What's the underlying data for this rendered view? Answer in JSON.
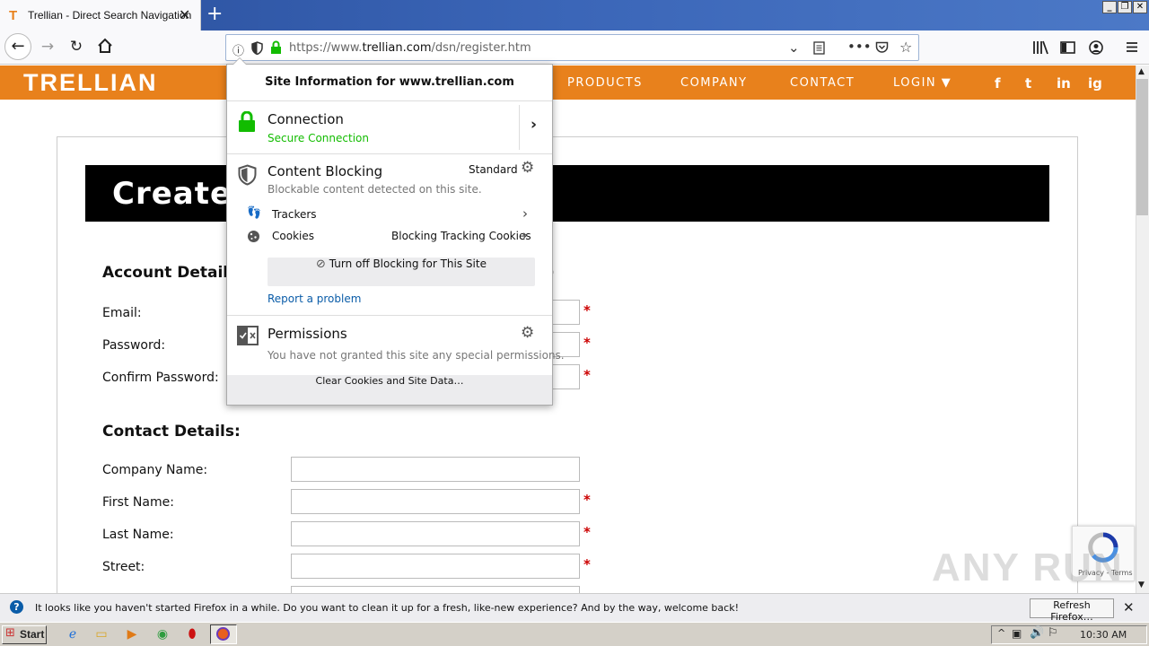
{
  "browser": {
    "tab": {
      "title": "Trellian - Direct Search Navigation",
      "favicon": "T"
    },
    "url": {
      "prefix": "https://www.",
      "domain": "trellian.com",
      "path": "/dsn/register.htm"
    }
  },
  "site": {
    "logo": "TRELLIAN",
    "menu": [
      "PRODUCTS",
      "COMPANY",
      "CONTACT",
      "LOGIN ▼"
    ],
    "social": [
      "f",
      "t",
      "in",
      "ig"
    ]
  },
  "page": {
    "banner": "Create",
    "account_title": "Account Details",
    "account_tail": ")",
    "account_fields": [
      "Email:",
      "Password:",
      "Confirm Password:"
    ],
    "contact_title": "Contact Details:",
    "contact_fields": [
      "Company Name:",
      "First Name:",
      "Last Name:",
      "Street:"
    ],
    "required_mark": "*"
  },
  "popup": {
    "title": "Site Information for www.trellian.com",
    "connection": {
      "heading": "Connection",
      "status": "Secure Connection"
    },
    "blocking": {
      "heading": "Content Blocking",
      "mode": "Standard",
      "desc": "Blockable content detected on this site.",
      "trackers_label": "Trackers",
      "cookies_label": "Cookies",
      "cookies_value": "Blocking Tracking Cookies",
      "turn_off": "Turn off Blocking for This Site",
      "report": "Report a problem"
    },
    "permissions": {
      "heading": "Permissions",
      "desc": "You have not granted this site any special permissions."
    },
    "clear_button": "Clear Cookies and Site Data…"
  },
  "recaptcha": {
    "links": "Privacy - Terms"
  },
  "notification": {
    "text": "It looks like you haven't started Firefox in a while. Do you want to clean it up for a fresh, like-new experience? And by the way, welcome back!",
    "button": "Refresh Firefox…"
  },
  "taskbar": {
    "start": "Start",
    "clock": "10:30 AM"
  },
  "watermark": "ANY RUN",
  "colors": {
    "brand": "#e8811c",
    "secure": "#12bc00",
    "link": "#0a5ca8"
  }
}
